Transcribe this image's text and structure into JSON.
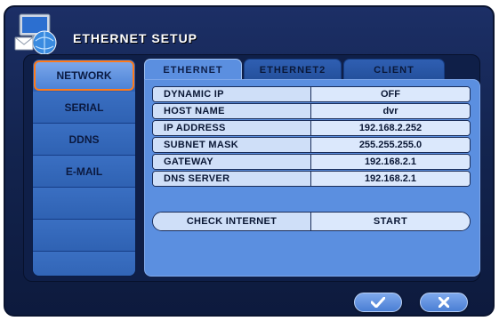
{
  "window": {
    "title": "ETHERNET SETUP"
  },
  "sidebar": {
    "items": [
      {
        "label": "NETWORK",
        "active": true
      },
      {
        "label": "SERIAL",
        "active": false
      },
      {
        "label": "DDNS",
        "active": false
      },
      {
        "label": "E-MAIL",
        "active": false
      },
      {
        "label": "",
        "active": false
      },
      {
        "label": "",
        "active": false
      },
      {
        "label": "",
        "active": false
      }
    ]
  },
  "tabs": [
    {
      "label": "ETHERNET",
      "active": true
    },
    {
      "label": "ETHERNET2",
      "active": false
    },
    {
      "label": "CLIENT",
      "active": false
    }
  ],
  "settings": [
    {
      "label": "DYNAMIC IP",
      "value": "OFF"
    },
    {
      "label": "HOST NAME",
      "value": "dvr"
    },
    {
      "label": "IP ADDRESS",
      "value": "192.168.2.252"
    },
    {
      "label": "SUBNET MASK",
      "value": "255.255.255.0"
    },
    {
      "label": "GATEWAY",
      "value": "192.168.2.1"
    },
    {
      "label": "DNS SERVER",
      "value": "192.168.2.1"
    }
  ],
  "check_internet": {
    "label": "CHECK INTERNET",
    "button": "START"
  },
  "actions": {
    "confirm_icon": "check-icon",
    "cancel_icon": "close-icon"
  },
  "colors": {
    "accent": "#ff7a1a",
    "panel": "#5b8fe0",
    "background": "#13244f"
  }
}
